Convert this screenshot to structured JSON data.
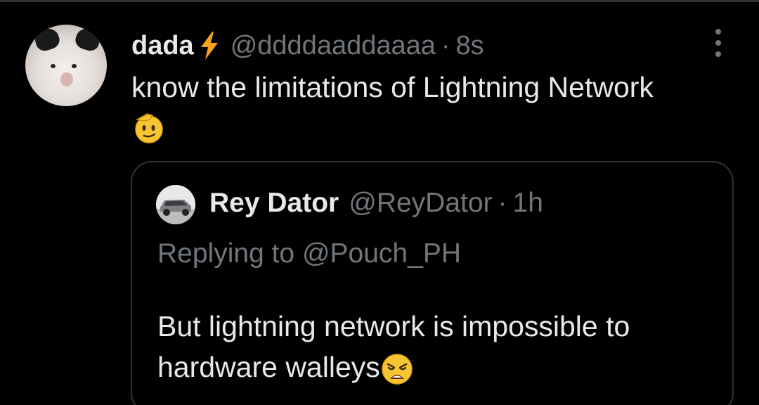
{
  "tweet": {
    "display_name": "dada",
    "badge_icon": "lightning-bolt-icon",
    "badge_color": "#f7a21b",
    "handle": "@ddddaaddaaaa",
    "separator": "·",
    "time": "8s",
    "text": "know the limitations of Lightning Network",
    "emoji_icon": "saluting-face-emoji"
  },
  "quoted_tweet": {
    "display_name": "Rey Dator",
    "handle": "@ReyDator",
    "separator": "·",
    "time": "1h",
    "replying_to": "Replying to @Pouch_PH",
    "text": "But lightning network is impossible to hardware walleys",
    "emoji_icon": "weary-face-emoji"
  },
  "colors": {
    "background": "#000000",
    "text": "#e7e9ea",
    "secondary": "#71767b",
    "border": "#2f3336"
  }
}
